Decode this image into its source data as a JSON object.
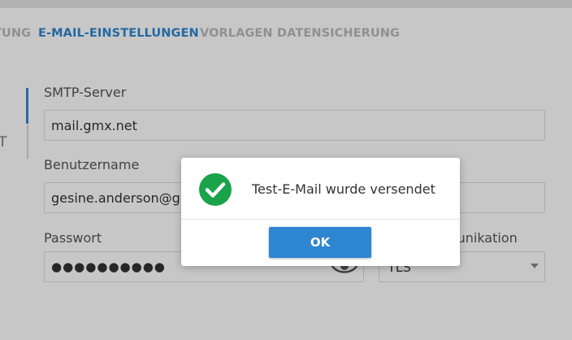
{
  "tabs": {
    "partial": "TUNG",
    "email": "E-MAIL-EINSTELLUNGEN",
    "templates": "VORLAGEN",
    "backup": "DATENSICHERUNG"
  },
  "sidebar": {
    "partial_letter": "T"
  },
  "form": {
    "smtp_label": "SMTP-Server",
    "smtp_value": "mail.gmx.net",
    "username_label": "Benutzername",
    "username_value": "gesine.anderson@gmx.net",
    "password_label": "Passwort",
    "password_value": "●●●●●●●●●●",
    "communication_label": "munikation",
    "communication_value": "TLS"
  },
  "dialog": {
    "message": "Test-E-Mail wurde versendet",
    "ok_label": "OK"
  },
  "colors": {
    "accent": "#2f86d0",
    "success": "#1aa34a"
  },
  "icons": {
    "success": "check-circle-icon",
    "password_toggle": "eye-icon",
    "dropdown": "caret-down-icon"
  }
}
